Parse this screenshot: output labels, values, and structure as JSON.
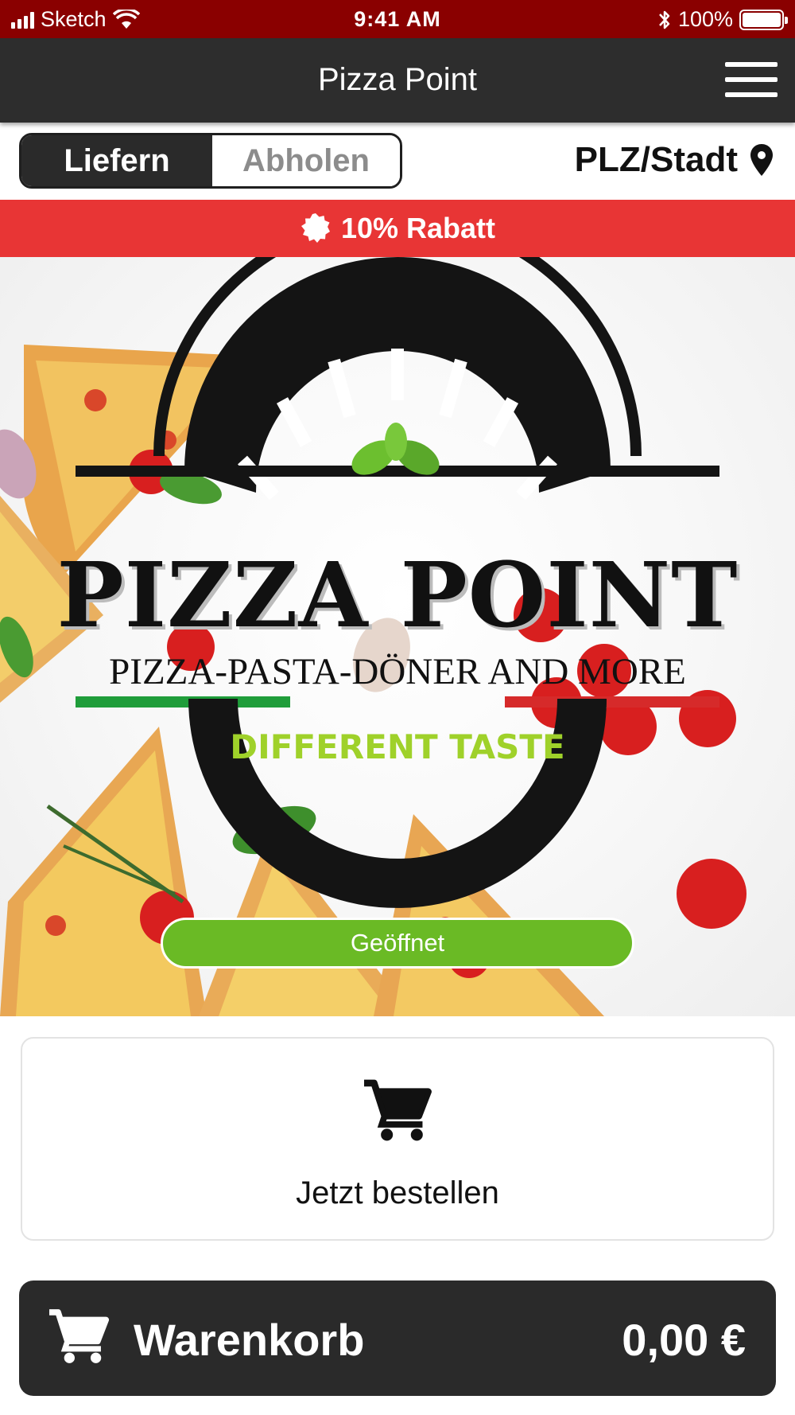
{
  "status_bar": {
    "carrier": "Sketch",
    "time": "9:41 AM",
    "battery": "100%",
    "signal_icon": "signal-bars-icon",
    "wifi_icon": "wifi-icon",
    "bluetooth_icon": "bluetooth-icon",
    "battery_icon": "battery-icon",
    "background": "#8a0000"
  },
  "nav": {
    "title": "Pizza Point",
    "menu_icon": "hamburger-menu-icon",
    "background": "#2d2d2d"
  },
  "order_mode": {
    "options": [
      "Liefern",
      "Abholen"
    ],
    "selected": "Liefern"
  },
  "location": {
    "label": "PLZ/Stadt",
    "icon": "map-pin-icon"
  },
  "discount": {
    "text": "10% Rabatt",
    "icon": "badge-icon",
    "color": "#e83535"
  },
  "hero": {
    "logo_title": "PIZZA POINT",
    "logo_subtitle": "PIZZA-PASTA-DÖNER AND MORE",
    "logo_tagline": "DIFFERENT TASTE",
    "status": "Geöffnet",
    "status_color": "#6aba25"
  },
  "order_card": {
    "label": "Jetzt bestellen",
    "icon": "cart-icon"
  },
  "basket": {
    "label": "Warenkorb",
    "total": "0,00 €",
    "icon": "cart-icon",
    "background": "#2a2a2a"
  }
}
